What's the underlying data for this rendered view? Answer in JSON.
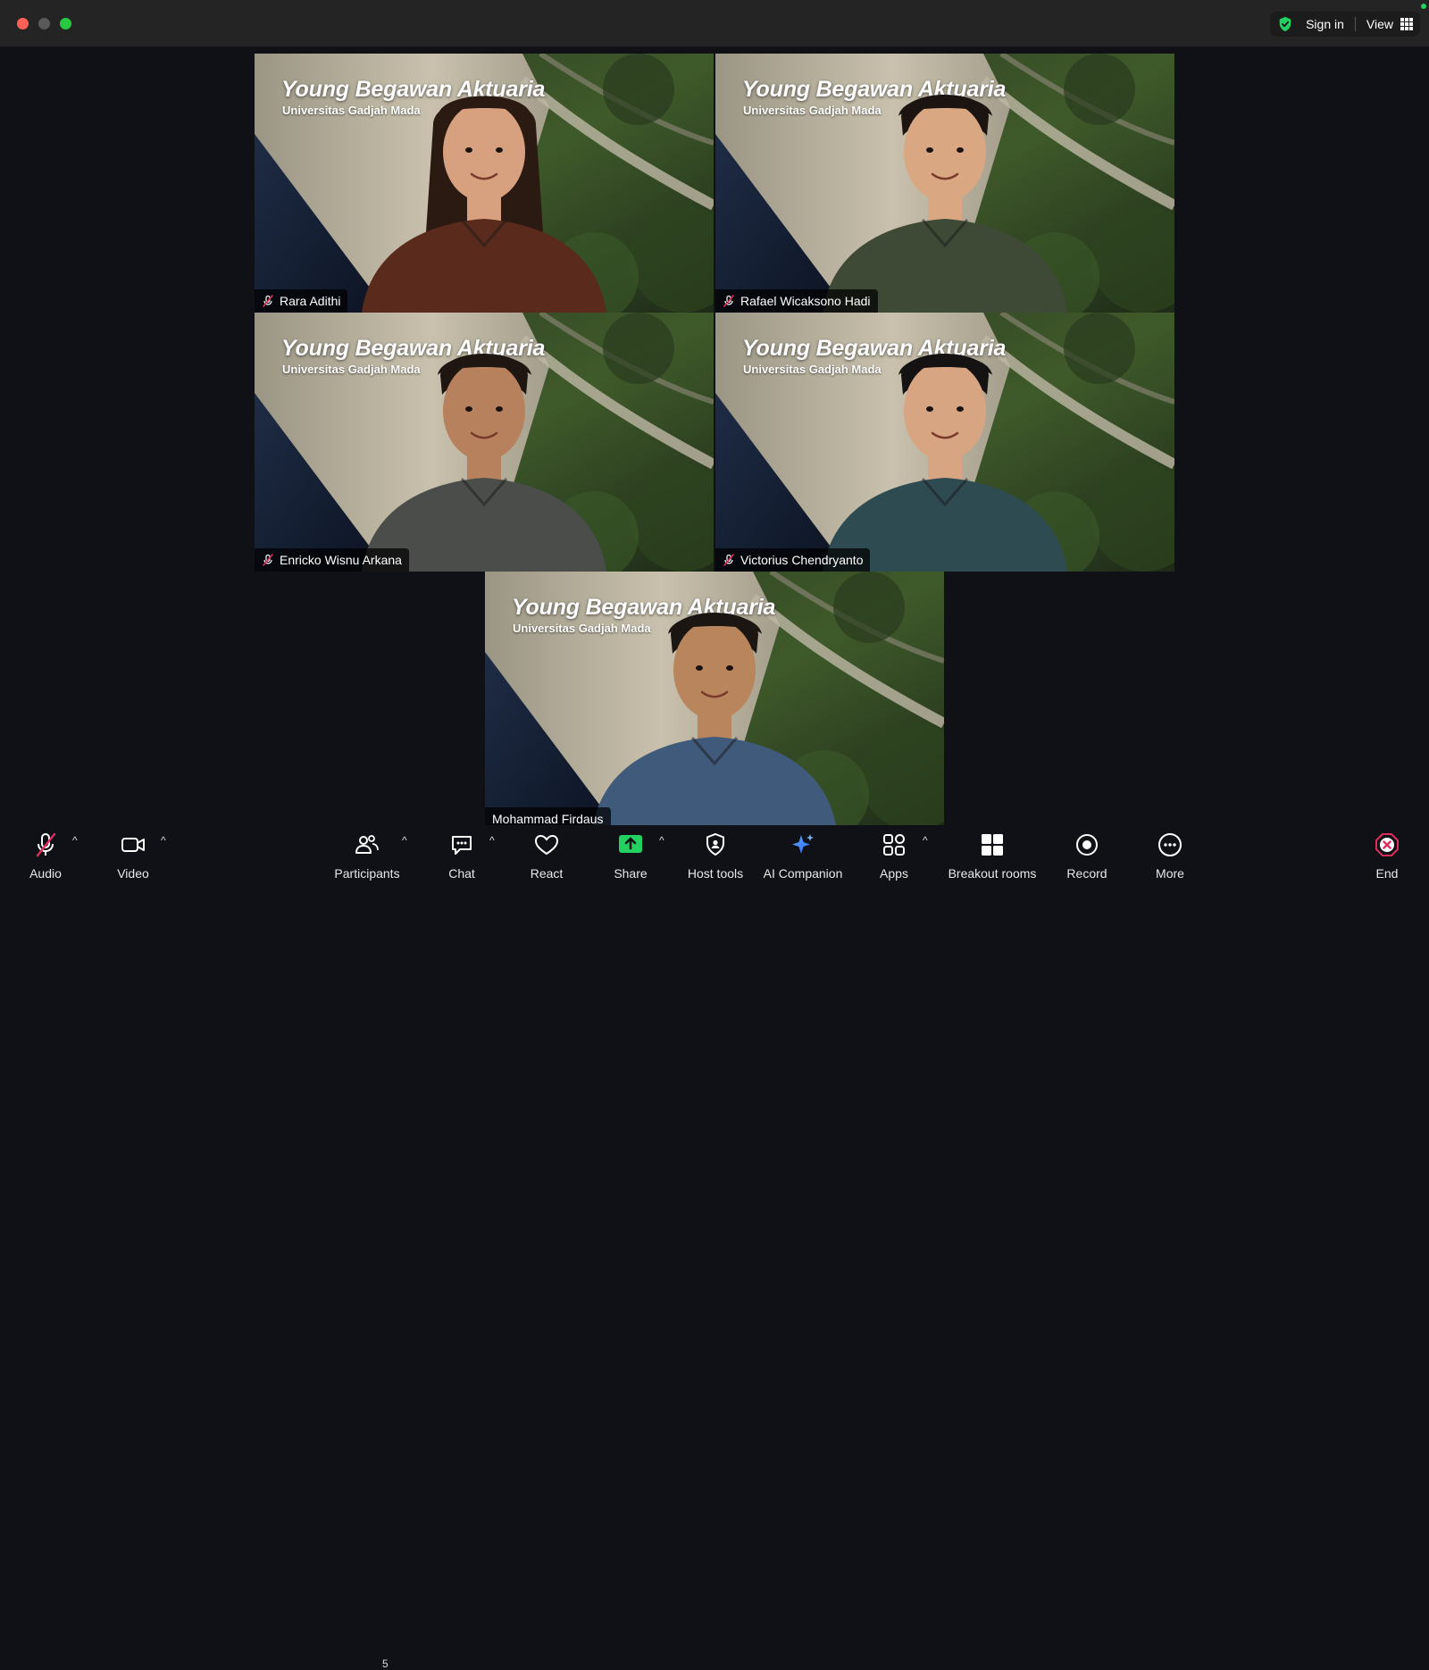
{
  "topbar": {
    "signin_label": "Sign in",
    "view_label": "View",
    "security_icon": "shield-check-icon",
    "view_icon": "grid-icon"
  },
  "meeting": {
    "background_title": "Young Begawan Aktuaria",
    "background_subtitle": "Universitas Gadjah Mada",
    "participants": [
      {
        "name": "Rara Adithi",
        "muted": true,
        "active": false
      },
      {
        "name": "Rafael Wicaksono Hadi",
        "muted": true,
        "active": false
      },
      {
        "name": "Enricko Wisnu Arkana",
        "muted": true,
        "active": false
      },
      {
        "name": "Victorius Chendryanto",
        "muted": true,
        "active": false
      },
      {
        "name": "Mohammad Firdaus",
        "muted": false,
        "active": true
      }
    ]
  },
  "toolbar": {
    "audio_label": "Audio",
    "video_label": "Video",
    "participants_label": "Participants",
    "participants_count": "5",
    "chat_label": "Chat",
    "react_label": "React",
    "share_label": "Share",
    "host_tools_label": "Host tools",
    "ai_companion_label": "AI Companion",
    "apps_label": "Apps",
    "breakout_label": "Breakout rooms",
    "record_label": "Record",
    "more_label": "More",
    "end_label": "End"
  },
  "colors": {
    "accent_green": "#2ecf53",
    "share_green": "#23d160",
    "end_red": "#e02e5c",
    "mute_red": "#e02e5c"
  }
}
